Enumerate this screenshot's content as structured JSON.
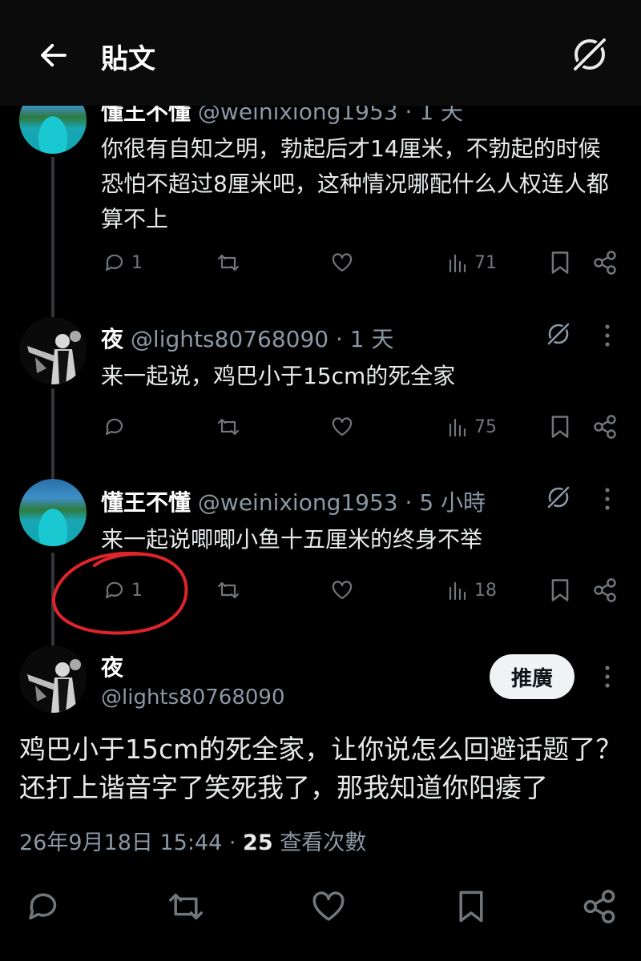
{
  "header": {
    "title": "貼文"
  },
  "thread": [
    {
      "name": "懂王不懂",
      "handle": "@weinixiong1953",
      "time": "· 1 天",
      "text": "你很有自知之明，勃起后才14厘米，不勃起的时候恐怕不超过8厘米吧，这种情况哪配什么人权连人都算不上",
      "replies": "1",
      "views": "71"
    },
    {
      "name": "夜",
      "handle": "@lights80768090",
      "time": "· 1 天",
      "text": "来一起说，鸡巴小于15cm的死全家",
      "replies": "",
      "views": "75"
    },
    {
      "name": "懂王不懂",
      "handle": "@weinixiong1953",
      "time": "· 5 小時",
      "text": "来一起说唧唧小鱼十五厘米的终身不举",
      "replies": "1",
      "views": "18"
    }
  ],
  "main_post": {
    "name": "夜",
    "handle": "@lights80768090",
    "promote_label": "推廣",
    "text": "鸡巴小于15cm的死全家，让你说怎么回避话题了？还打上谐音字了笑死我了，那我知道你阳痿了",
    "date": "26年9月18日 15:44",
    "sep": " · ",
    "views_count": "25",
    "views_label": " 查看次數"
  },
  "icons": [
    "back-arrow-icon",
    "grok-icon",
    "reply-icon",
    "retweet-icon",
    "like-icon",
    "views-icon",
    "bookmark-icon",
    "share-icon",
    "more-icon"
  ],
  "colors": {
    "background": "#000000",
    "text": "#e7e9ea",
    "muted": "#71767b",
    "annotation": "#e0242b"
  }
}
